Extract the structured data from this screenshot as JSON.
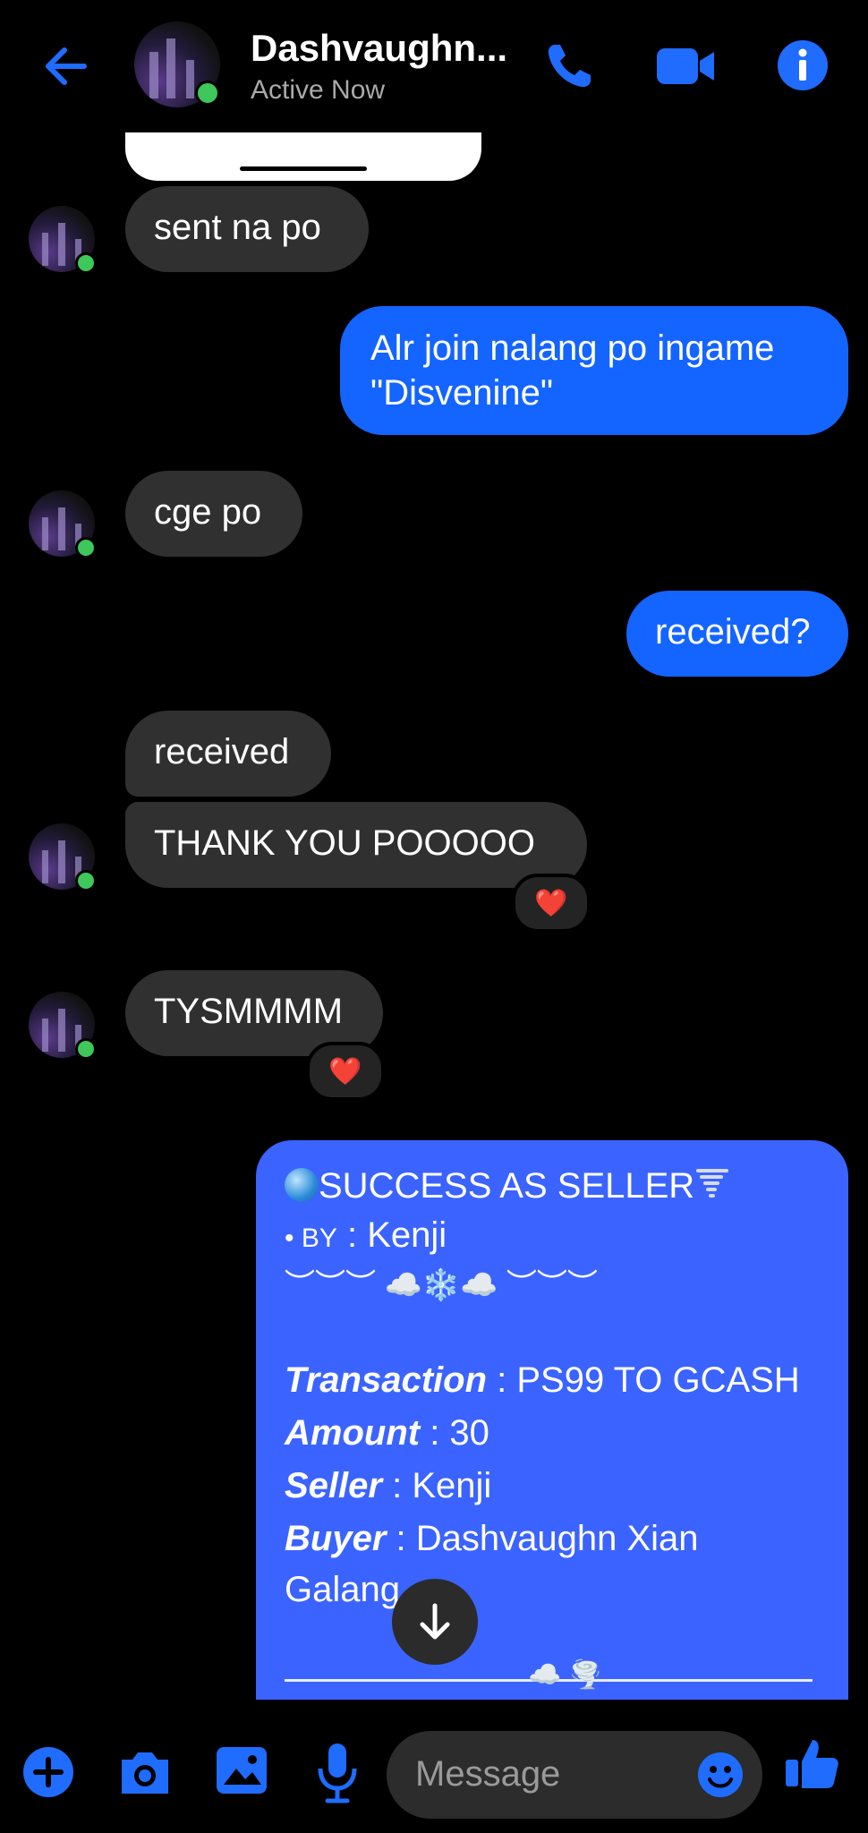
{
  "header": {
    "contact_name": "Dashvaughn...",
    "status": "Active Now"
  },
  "icons": {
    "back": "back-arrow-icon",
    "call": "phone-icon",
    "video": "video-camera-icon",
    "info": "info-icon"
  },
  "messages": [
    {
      "from": "them",
      "text": "sent na po"
    },
    {
      "from": "me",
      "text": "Alr join nalang po ingame \"Disvenine\""
    },
    {
      "from": "them",
      "text": "cge po"
    },
    {
      "from": "me",
      "text": "received?"
    },
    {
      "from": "them",
      "text": "received"
    },
    {
      "from": "them",
      "text": "THANK YOU POOOOO",
      "reaction": "❤️"
    },
    {
      "from": "them",
      "text": "TYSMMMM",
      "reaction": "❤️"
    }
  ],
  "card": {
    "title": "SUCCESS AS SELLER",
    "by_label": "• BY",
    "by_value": ": Kenji",
    "deco_line": "︶︶︶ ☁️❄️☁️ ︶︶︶",
    "transaction_label": "Transaction",
    "transaction_value": ": PS99 TO GCASH",
    "amount_label": "Amount",
    "amount_value": ": 30",
    "seller_label": "Seller",
    "seller_value": ": Kenji",
    "buyer_label": "Buyer",
    "buyer_value": ": Dashvaughn Xian",
    "buyer_value_cont": "Galang",
    "bottom_deco": "☁️ 🌪️"
  },
  "composer": {
    "placeholder": "Message"
  },
  "colors": {
    "accent": "#1f6cff",
    "outgoing_bubble": "#1464ff",
    "incoming_bubble": "#303030",
    "card_bg": "#3b63ff",
    "online": "#3ec75a"
  }
}
